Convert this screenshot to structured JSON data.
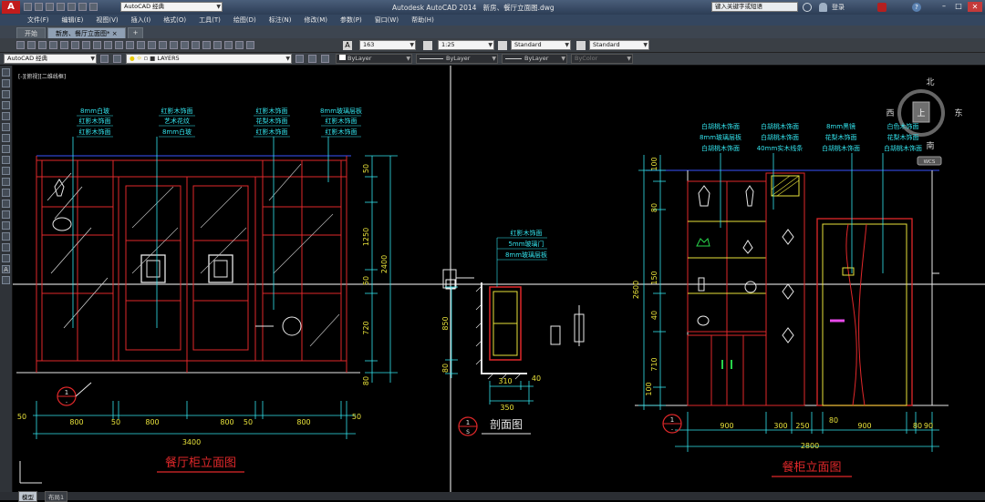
{
  "titlebar": {
    "app_name": "Autodesk AutoCAD 2014",
    "file_name": "新房、餐厅立面图.dwg",
    "workspace": "AutoCAD 经典",
    "search_placeholder": "键入关键字或短语",
    "user": "登录"
  },
  "menu": [
    "文件(F)",
    "编辑(E)",
    "视图(V)",
    "插入(I)",
    "格式(O)",
    "工具(T)",
    "绘图(D)",
    "标注(N)",
    "修改(M)",
    "参数(P)",
    "窗口(W)",
    "帮助(H)"
  ],
  "tabs": [
    "开始",
    "新房、餐厅立面图*"
  ],
  "toolbar": {
    "annotation_scale": "163",
    "scale": "1:25",
    "text_style": "Standard",
    "dim_style": "Standard"
  },
  "toolbar2": {
    "workspace": "AutoCAD 经典",
    "layer": "LAYER5",
    "color": "ByLayer",
    "linetype": "ByLayer",
    "lineweight": "ByLayer",
    "plotstyle": "ByColor"
  },
  "viewport_label": "[-][俯视][二维线框]",
  "viewcube": {
    "north": "北",
    "south": "南",
    "east": "东",
    "west": "西",
    "top": "上",
    "wcs": "WCS"
  },
  "layout_tabs": [
    "模型",
    "布局1"
  ],
  "left_elevation": {
    "title": "餐厅柜立面图",
    "callout_top": "1",
    "callout_bottom": "-",
    "notes": [
      [
        "8mm白玻",
        "红影木饰面",
        "红影木饰面"
      ],
      [
        "红影木饰面",
        "艺术花纹",
        "8mm白玻"
      ],
      [
        "红影木饰面",
        "花梨木饰面",
        "红影木饰面"
      ],
      [
        "8mm玻璃层板",
        "红影木饰面",
        "红影木饰面"
      ]
    ],
    "bottom_dims": [
      "800",
      "50",
      "800",
      "800",
      "50",
      "800",
      "50",
      "50"
    ],
    "total_width": "3400",
    "right_dims": [
      "50",
      "1250",
      "50",
      "720",
      "80",
      "2400"
    ]
  },
  "section": {
    "title": "剖面图",
    "callout_top": "1",
    "callout_bottom": "S",
    "notes": [
      "红影木饰面",
      "5mm玻璃门",
      "8mm玻璃层板"
    ],
    "left_dims": [
      "850",
      "80"
    ],
    "bottom_dims": [
      "310",
      "40",
      "350"
    ]
  },
  "right_elevation": {
    "title": "餐柜立面图",
    "callout_top": "1",
    "callout_bottom": "-",
    "notes_a": [
      "白胡桃木饰面",
      "8mm玻璃层板",
      "白胡桃木饰面"
    ],
    "notes_b": [
      "白胡桃木饰面",
      "白胡桃木饰面",
      "40mm实木线条"
    ],
    "notes_c": [
      "8mm黑镜",
      "花梨木饰面",
      "白胡桃木饰面"
    ],
    "notes_d": [
      "白色木饰面",
      "花梨木饰面",
      "白胡桃木饰面"
    ],
    "left_dims": [
      "100",
      "80",
      "150",
      "40",
      "710",
      "100",
      "2600"
    ],
    "bottom_dims": [
      "900",
      "300",
      "250",
      "80",
      "900",
      "80",
      "90"
    ],
    "total_width": "2800"
  },
  "colors": {
    "red": "#e0282a",
    "cyan": "#33e4ee",
    "white": "#e8e8e8",
    "yellow": "#e8e23a",
    "green": "#28d34a",
    "blue": "#3a55ff",
    "magenta": "#e94aeb"
  }
}
